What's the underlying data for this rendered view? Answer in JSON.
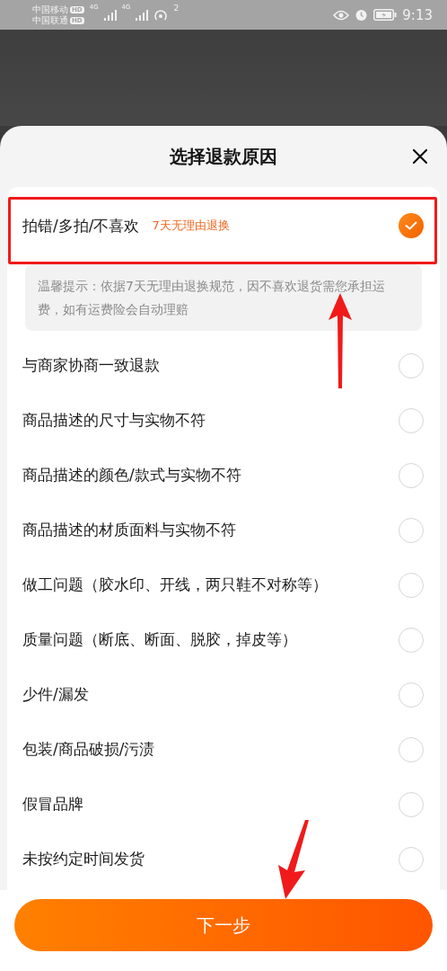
{
  "status_bar": {
    "carriers": [
      {
        "name": "中国移动",
        "badge": "HD"
      },
      {
        "name": "中国联通",
        "badge": "HD"
      }
    ],
    "networks": [
      "4G",
      "4G"
    ],
    "hotspot_count": "2",
    "time": "9:13"
  },
  "sheet": {
    "title": "选择退款原因"
  },
  "reasons": [
    {
      "label": "拍错/多拍/不喜欢",
      "tag": "7天无理由退换",
      "selected": true,
      "note": "温馨提示：依据7天无理由退换规范，因不喜欢退货需您承担运费，如有运费险会自动理赔"
    },
    {
      "label": "与商家协商一致退款",
      "selected": false
    },
    {
      "label": "商品描述的尺寸与实物不符",
      "selected": false
    },
    {
      "label": "商品描述的颜色/款式与实物不符",
      "selected": false
    },
    {
      "label": "商品描述的材质面料与实物不符",
      "selected": false
    },
    {
      "label": "做工问题（胶水印、开线，两只鞋不对称等）",
      "selected": false
    },
    {
      "label": "质量问题（断底、断面、脱胶，掉皮等）",
      "selected": false
    },
    {
      "label": "少件/漏发",
      "selected": false
    },
    {
      "label": "包装/商品破损/污渍",
      "selected": false
    },
    {
      "label": "假冒品牌",
      "selected": false
    },
    {
      "label": "未按约定时间发货",
      "selected": false
    }
  ],
  "next_button": "下一步"
}
